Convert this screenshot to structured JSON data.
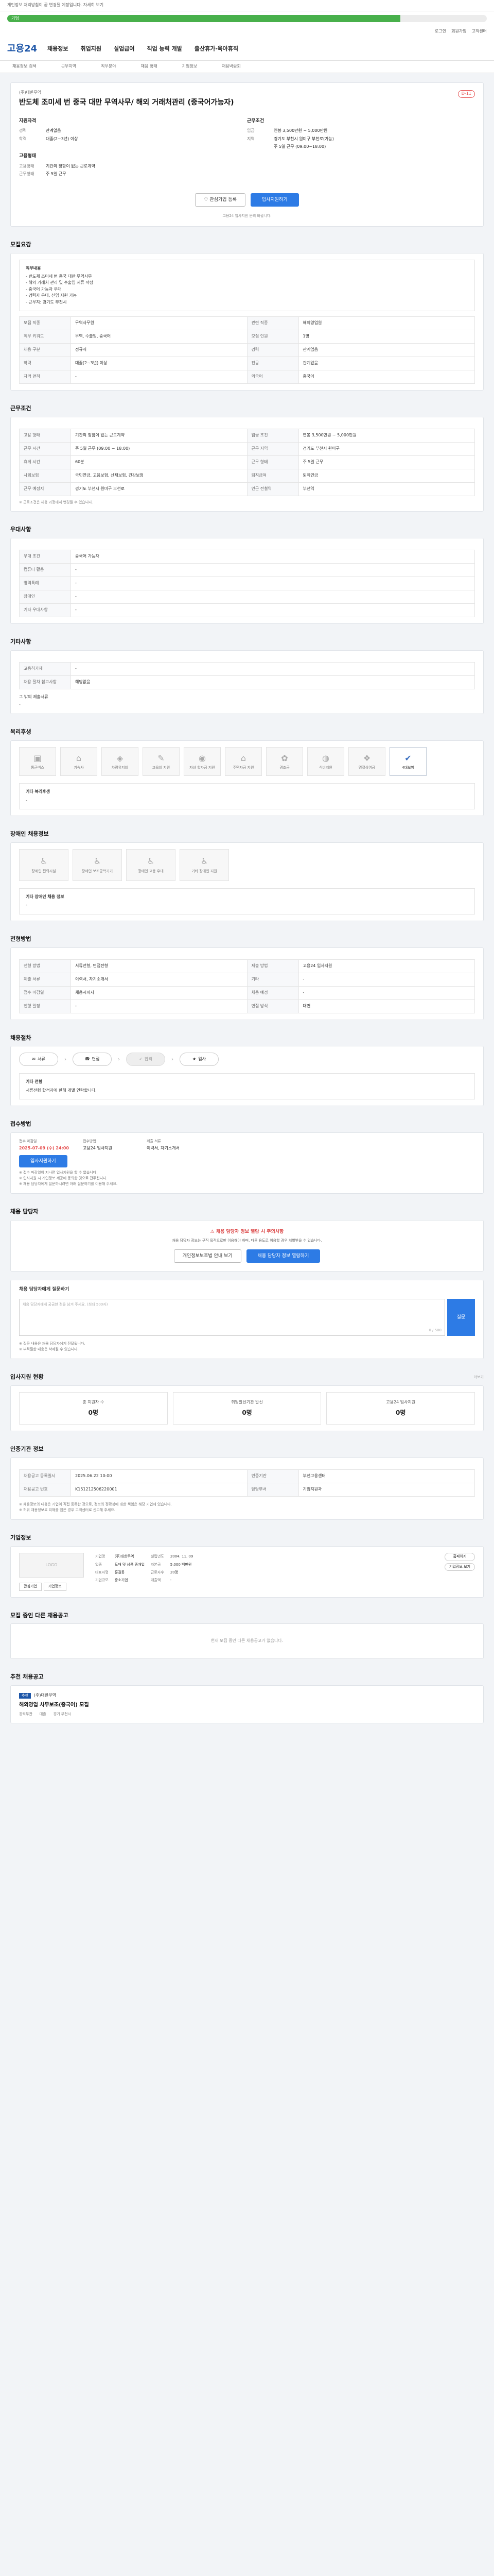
{
  "notice": {
    "text": "개인정보 처리방침이 곧 변경될 예정입니다. 자세히 보기"
  },
  "progress": {
    "value": 0.82,
    "label": "기업"
  },
  "util": {
    "items": [
      "로그인",
      "회원가입",
      "고객센터"
    ]
  },
  "header": {
    "logo": "고용24",
    "nav": [
      "채용정보",
      "취업지원",
      "실업급여",
      "직업 능력 개발",
      "출산휴가·육아휴직"
    ]
  },
  "subnav": {
    "items": [
      "채용정보 검색",
      "근무지역",
      "직무분야",
      "채용 형태",
      "기업정보",
      "채용박람회"
    ]
  },
  "job": {
    "company": "(주)대한무역",
    "title": "반도체 조미세 번 중국 대만 무역사무/ 해외 거래처관리 (중국어가능자)",
    "dday": "D-11",
    "req_head": "지원자격",
    "cond_head": "근무조건",
    "req": [
      {
        "k": "경력",
        "v": "관계없음"
      },
      {
        "k": "학력",
        "v": "대졸(2~3년) 이상"
      }
    ],
    "cond": [
      {
        "k": "임금",
        "v": "연봉 3,500만원 ~ 5,000만원"
      },
      {
        "k": "지역",
        "v": "경기도 부천시 원미구 부천로(가능)"
      },
      {
        "k": "",
        "v": "주 5일 근무 (09:00~18:00)"
      }
    ],
    "emp_head": "고용형태",
    "emp": [
      {
        "k": "고용형태",
        "v": "기간의 정함이 없는 근로계약"
      },
      {
        "k": "근무형태",
        "v": "주 5일 근무"
      }
    ],
    "interest": "관심기업 등록",
    "apply": "입사지원하기",
    "note": "고용24 입사지원 문의 바랍니다."
  },
  "sections": {
    "recruit_title": "모집요강",
    "cond_title": "근무조건",
    "prefer_title": "우대사항",
    "other_title": "기타사항",
    "welfare_title": "복리후생",
    "welfare2_title": "장애인 채용정보",
    "process_title": "전형방법",
    "proc_title": "채용절차",
    "apply_title": "접수방법",
    "manager_title": "채용 담당자",
    "qa_title": "채용 담당자에게 질문하기",
    "stats_title": "입사지원 현황",
    "register_title": "인증기관 정보",
    "corp_title": "기업정보",
    "similar_title": "모집 중인 다른 채용공고",
    "recommend_title": "추천 채용공고"
  },
  "recruit": {
    "box_head": "직무내용",
    "lines": [
      "- 반도체 조미세 번 중국 대만 무역사무",
      "- 해외 거래처 관리 및 수출입 서류 작성",
      "- 중국어 가능자 우대",
      "- 경력자 우대, 신입 지원 가능",
      "- 근무지: 경기도 부천시"
    ],
    "rows": [
      [
        {
          "k": "모집 직종",
          "v": "무역사무원"
        },
        {
          "k": "관련 직종",
          "v": "해외영업원"
        }
      ],
      [
        {
          "k": "직무 키워드",
          "v": "무역, 수출입, 중국어"
        },
        {
          "k": "모집 인원",
          "v": "1명"
        }
      ],
      [
        {
          "k": "채용 구분",
          "v": "정규직"
        },
        {
          "k": "경력",
          "v": "관계없음"
        }
      ],
      [
        {
          "k": "학력",
          "v": "대졸(2~3년) 이상"
        },
        {
          "k": "전공",
          "v": "관계없음"
        }
      ],
      [
        {
          "k": "자격 면허",
          "v": "-"
        },
        {
          "k": "외국어",
          "v": "중국어"
        }
      ]
    ]
  },
  "cond": {
    "rows": [
      [
        {
          "k": "고용 형태",
          "v": "기간의 정함이 없는 근로계약"
        },
        {
          "k": "임금 조건",
          "v": "연봉 3,500만원 ~ 5,000만원"
        }
      ],
      [
        {
          "k": "근무 시간",
          "v": "주 5일 근무 (09:00 ~ 18:00)"
        },
        {
          "k": "근무 지역",
          "v": "경기도 부천시 원미구"
        }
      ],
      [
        {
          "k": "휴게 시간",
          "v": "60분"
        },
        {
          "k": "근무 형태",
          "v": "주 5일 근무"
        }
      ],
      [
        {
          "k": "사회보험",
          "v": "국민연금, 고용보험, 산재보험, 건강보험"
        },
        {
          "k": "퇴직급여",
          "v": "퇴직연금"
        }
      ],
      [
        {
          "k": "근무 예정지",
          "v": "경기도 부천시 원미구 부천로"
        },
        {
          "k": "인근 전철역",
          "v": "부천역"
        }
      ]
    ],
    "note": "※ 근로조건은 채용 과정에서 변경될 수 있습니다."
  },
  "prefer": {
    "rows": [
      {
        "k": "우대 조건",
        "v": "중국어 가능자"
      },
      {
        "k": "컴퓨터 활용",
        "v": "-"
      },
      {
        "k": "병역특례",
        "v": "-"
      },
      {
        "k": "장애인",
        "v": "-"
      },
      {
        "k": "기타 우대사항",
        "v": "-"
      }
    ]
  },
  "other": {
    "rows": [
      {
        "k": "고용허가제",
        "v": "-"
      },
      {
        "k": "채용 절차 참고사항",
        "v": "해당없음"
      }
    ],
    "extra_h": "그 밖의 제출서류",
    "extra_v": "-"
  },
  "welfare": {
    "items": [
      {
        "l": "통근버스",
        "on": false
      },
      {
        "l": "기숙사",
        "on": false
      },
      {
        "l": "차량유지비",
        "on": false
      },
      {
        "l": "교육비 지원",
        "on": false
      },
      {
        "l": "자녀 학자금 지원",
        "on": false
      },
      {
        "l": "주택자금 지원",
        "on": false
      },
      {
        "l": "경조금",
        "on": false
      },
      {
        "l": "식비지원",
        "on": false
      },
      {
        "l": "명절상여금",
        "on": false
      },
      {
        "l": "4대보험",
        "on": true
      }
    ],
    "note_h": "기타 복리후생",
    "note_v": "-"
  },
  "welfare2": {
    "items": [
      {
        "l": "장애인 편의시설"
      },
      {
        "l": "장애인 보조공학기기"
      },
      {
        "l": "장애인 고용 우대"
      },
      {
        "l": "기타 장애인 지원"
      }
    ],
    "note_h": "기타 장애인 채용 정보",
    "note_v": "-"
  },
  "process": {
    "rows": [
      {
        "k": "전형 방법",
        "v": "서류전형, 면접전형"
      },
      {
        "k": "제출 서류",
        "v": "이력서, 자기소개서"
      },
      {
        "k": "접수 마감일",
        "v": "채용시까지"
      },
      {
        "k": "전형 일정",
        "v": "-"
      }
    ],
    "rows_r": [
      {
        "k": "제출 방법",
        "v": "고용24 입사지원"
      },
      {
        "k": "기타",
        "v": "-"
      },
      {
        "k": "채용 예정",
        "v": "-"
      },
      {
        "k": "면접 방식",
        "v": "대면"
      }
    ]
  },
  "proc": {
    "steps": [
      {
        "l": "서류",
        "ic": "✉",
        "on": true
      },
      {
        "l": "면접",
        "ic": "☎",
        "on": true
      },
      {
        "l": "합격",
        "ic": "✓",
        "on": false
      },
      {
        "l": "입사",
        "ic": "★",
        "on": true
      }
    ],
    "note_h": "기타 전형",
    "note_v": "서류전형 합격자에 한해 개별 연락합니다."
  },
  "apply": {
    "cols": [
      {
        "l": "접수 마감일",
        "v": "2025-07-09 (수) 24:00",
        "red": true
      },
      {
        "l": "접수방법",
        "v": "고용24 입사지원",
        "red": false
      },
      {
        "l": "제출 서류",
        "v": "이력서, 자기소개서",
        "red": false
      }
    ],
    "btn": "입사지원하기",
    "notes": [
      "※ 접수 마감일이 지나면 입사지원을 할 수 없습니다.",
      "※ 입사지원 시 개인정보 제공에 동의한 것으로 간주됩니다.",
      "※ 채용 담당자에게 질문하시려면 아래 질문하기를 이용해 주세요."
    ]
  },
  "manager": {
    "warn_h": "채용 담당자 정보 열람 시 주의사항",
    "warn_p": "채용 담당자 정보는 구직 목적으로만 이용해야 하며, 다른 용도로 이용할 경우 처벌받을 수 있습니다.",
    "btn1": "개인정보보호법 안내 보기",
    "btn2": "채용 담당자 정보 열람하기"
  },
  "qa": {
    "placeholder": "채용 담당자에게 궁금한 점을 남겨 주세요. (최대 500자)",
    "count": "0 / 500",
    "btn": "질문",
    "notes": [
      "※ 질문 내용은 채용 담당자에게 전달됩니다.",
      "※ 부적절한 내용은 삭제될 수 있습니다."
    ]
  },
  "stats": {
    "items": [
      {
        "l": "총 지원자 수",
        "v": "0명"
      },
      {
        "l": "취업알선기관 알선",
        "v": "0명"
      },
      {
        "l": "고용24 입사지원",
        "v": "0명"
      }
    ],
    "more": "더보기"
  },
  "register": {
    "rows": [
      {
        "k": "채용공고 등록일시",
        "v": "2025.06.22 10:00"
      },
      {
        "k": "채용공고 번호",
        "v": "K151212506220001"
      }
    ],
    "rows_r": [
      {
        "k": "인증기관",
        "v": "부천고용센터"
      },
      {
        "k": "담당부서",
        "v": "기업지원과"
      }
    ],
    "notes": [
      "※ 채용정보의 내용은 기업이 직접 등록한 것으로, 정보의 정확성에 대한 책임은 해당 기업에 있습니다.",
      "※ 허위 채용정보로 피해를 입은 경우 고객센터로 신고해 주세요."
    ]
  },
  "corp": {
    "logo": "LOGO",
    "rows": [
      {
        "k": "기업명",
        "v": "(주)대한무역"
      },
      {
        "k": "업종",
        "v": "도매 및 상품 중개업"
      },
      {
        "k": "대표자명",
        "v": "홍길동"
      },
      {
        "k": "기업규모",
        "v": "중소기업"
      }
    ],
    "rows_r": [
      {
        "k": "설립년도",
        "v": "2004. 11. 09"
      },
      {
        "k": "자본금",
        "v": "5,000 백만원"
      },
      {
        "k": "근로자수",
        "v": "20명"
      },
      {
        "k": "매출액",
        "v": "-"
      }
    ],
    "pills": [
      "홈페이지",
      "기업정보 보기"
    ],
    "mini": [
      "관심기업",
      "기업정보"
    ]
  },
  "similar": {
    "empty": "현재 모집 중인 다른 채용공고가 없습니다."
  },
  "recommend": {
    "tag": "추천",
    "company": "(주)대한무역",
    "title": "해외영업 사무보조(중국어) 모집",
    "meta": [
      "경력무관",
      "대졸",
      "경기 부천시"
    ]
  }
}
